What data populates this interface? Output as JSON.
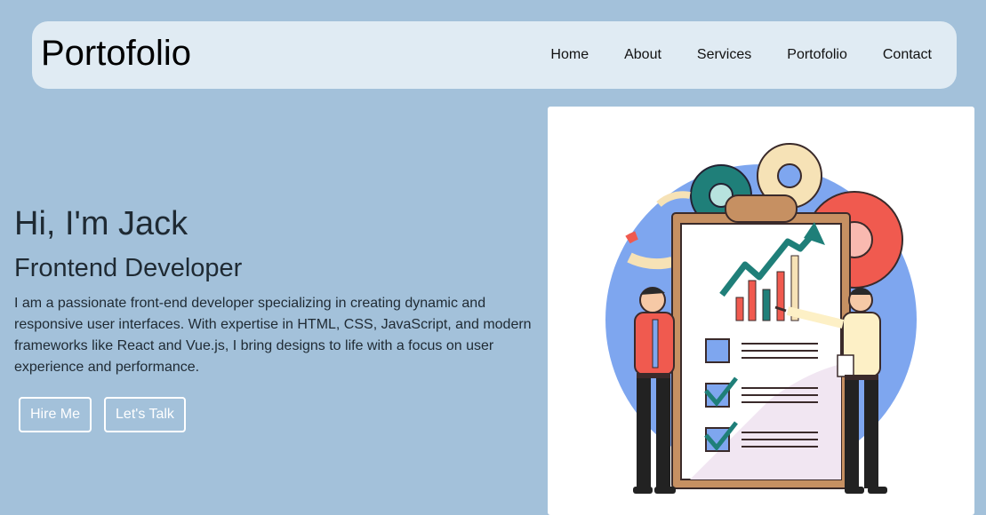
{
  "header": {
    "logo": "Portofolio",
    "nav": [
      {
        "label": "Home"
      },
      {
        "label": "About"
      },
      {
        "label": "Services"
      },
      {
        "label": "Portofolio"
      },
      {
        "label": "Contact"
      }
    ]
  },
  "hero": {
    "greeting": "Hi, I'm Jack",
    "role": "Frontend Developer",
    "bio": "I am a passionate front-end developer specializing in creating dynamic and responsive user interfaces. With expertise in HTML, CSS, JavaScript, and modern frameworks like React and Vue.js, I bring designs to life with a focus on user experience and performance.",
    "buttons": {
      "hire": "Hire Me",
      "talk": "Let's Talk"
    }
  },
  "colors": {
    "background": "#a3c1da",
    "navbar": "#e0ebf3",
    "card": "#ffffff",
    "text": "#1f2a33"
  },
  "illustration": {
    "icon": "business-presentation-illustration"
  }
}
